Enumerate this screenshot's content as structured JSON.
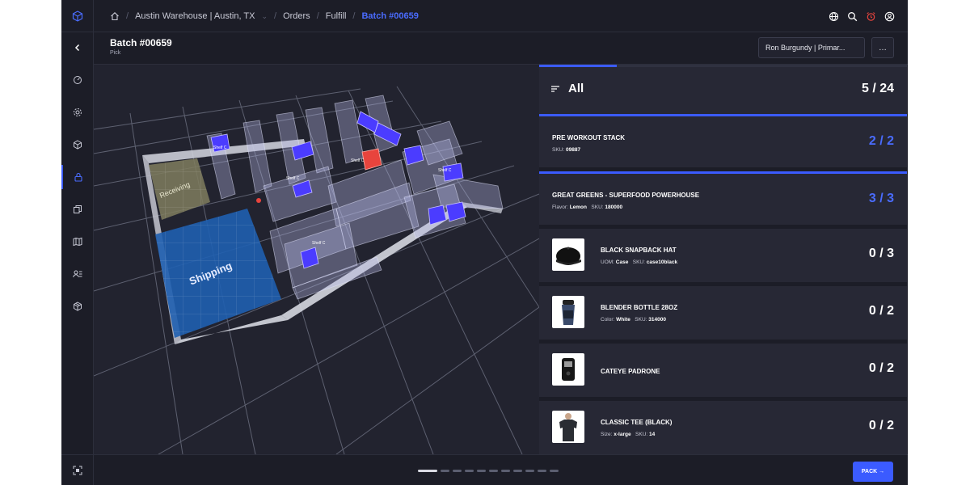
{
  "breadcrumb": [
    "Austin Warehouse | Austin, TX",
    "Orders",
    "Fulfill",
    "Batch #00659"
  ],
  "header": {
    "title": "Batch #00659",
    "subtitle": "Pick",
    "user_button": "Ron Burgundy | Primar...",
    "more_button": "…"
  },
  "map": {
    "zones": {
      "receiving": "Receiving",
      "shipping": "Shipping"
    },
    "shelf_label": "Shelf C"
  },
  "picklist": {
    "filter_label": "All",
    "total": "5 / 24",
    "progress": 0.21,
    "items": [
      {
        "name": "PRE WORKOUT STACK",
        "meta": [
          [
            "SKU",
            "09887"
          ]
        ],
        "count": "2 / 2",
        "done": true,
        "has_thumb": false
      },
      {
        "name": "GREAT GREENS - SUPERFOOD POWERHOUSE",
        "meta": [
          [
            "Flavor",
            "Lemon"
          ],
          [
            "SKU",
            "180000"
          ]
        ],
        "count": "3 / 3",
        "done": true,
        "has_thumb": false
      },
      {
        "name": "BLACK SNAPBACK HAT",
        "meta": [
          [
            "UOM",
            "Case"
          ],
          [
            "SKU",
            "case10black"
          ]
        ],
        "count": "0 / 3",
        "done": false,
        "has_thumb": true,
        "thumb": "hat"
      },
      {
        "name": "BLENDER BOTTLE 28OZ",
        "meta": [
          [
            "Color",
            "White"
          ],
          [
            "SKU",
            "314000"
          ]
        ],
        "count": "0 / 2",
        "done": false,
        "has_thumb": true,
        "thumb": "bottle"
      },
      {
        "name": "CATEYE PADRONE",
        "meta": [],
        "count": "0 / 2",
        "done": false,
        "has_thumb": true,
        "thumb": "device"
      },
      {
        "name": "CLASSIC TEE (BLACK)",
        "meta": [
          [
            "Size",
            "x-large"
          ],
          [
            "SKU",
            "14"
          ]
        ],
        "count": "0 / 2",
        "done": false,
        "has_thumb": true,
        "thumb": "tee"
      }
    ]
  },
  "footer": {
    "pack_button": "PACK →",
    "pagination_count": 11,
    "pagination_active": 0
  },
  "colors": {
    "accent": "#3b5bff",
    "highlight": "#e8443d",
    "shipping": "#1f5fb0",
    "receiving": "#7f7d5e"
  },
  "icons": [
    "cube-icon",
    "chevron-left-icon",
    "dashboard-icon",
    "settings-icon",
    "box-icon",
    "lock-icon",
    "copy-icon",
    "map-icon",
    "users-icon",
    "package-icon",
    "scan-icon",
    "globe-icon",
    "search-icon",
    "alarm-icon",
    "user-circle-icon",
    "home-icon",
    "filter-icon"
  ]
}
